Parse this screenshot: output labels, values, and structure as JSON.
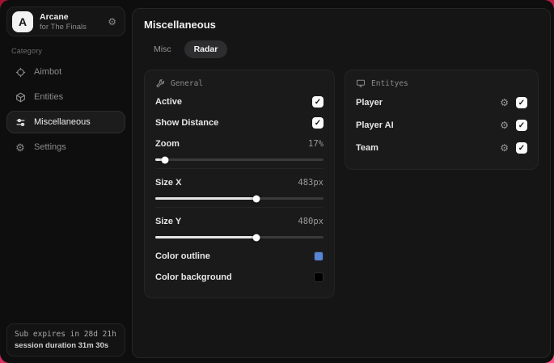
{
  "app": {
    "logo_letter": "A",
    "name": "Arcane",
    "subtitle": "for The Finals"
  },
  "icons": {
    "check": "✓",
    "gear": "⚙"
  },
  "sidebar": {
    "category_label": "Category",
    "items": [
      {
        "label": "Aimbot",
        "icon": "crosshair-icon",
        "selected": false
      },
      {
        "label": "Entities",
        "icon": "cube-icon",
        "selected": false
      },
      {
        "label": "Miscellaneous",
        "icon": "sliders-icon",
        "selected": true
      },
      {
        "label": "Settings",
        "icon": "gear-icon",
        "selected": false
      }
    ],
    "sub_box": {
      "line1": "Sub expires in 28d 21h",
      "line2": "session duration 31m 30s"
    }
  },
  "header": {
    "title": "Miscellaneous",
    "tabs": [
      {
        "label": "Misc",
        "selected": false
      },
      {
        "label": "Radar",
        "selected": true
      }
    ]
  },
  "general": {
    "title": "General",
    "toggles": [
      {
        "label": "Active",
        "checked": true
      },
      {
        "label": "Show Distance",
        "checked": true
      }
    ],
    "sliders": [
      {
        "label": "Zoom",
        "value": "17%",
        "fill": "6%"
      },
      {
        "label": "Size X",
        "value": "483px",
        "fill": "60%"
      },
      {
        "label": "Size Y",
        "value": "480px",
        "fill": "60%"
      }
    ],
    "colors": [
      {
        "label": "Color outline",
        "color": "#5585d6"
      },
      {
        "label": "Color background",
        "color": "#000000"
      }
    ]
  },
  "entities": {
    "title": "Entityes",
    "rows": [
      {
        "label": "Player",
        "checked": true
      },
      {
        "label": "Player AI",
        "checked": true
      },
      {
        "label": "Team",
        "checked": true
      }
    ]
  },
  "theme": {
    "accent_blue": "#5585d6",
    "desktop_gradient_start": "#a31233",
    "desktop_gradient_end": "#ff5585"
  }
}
